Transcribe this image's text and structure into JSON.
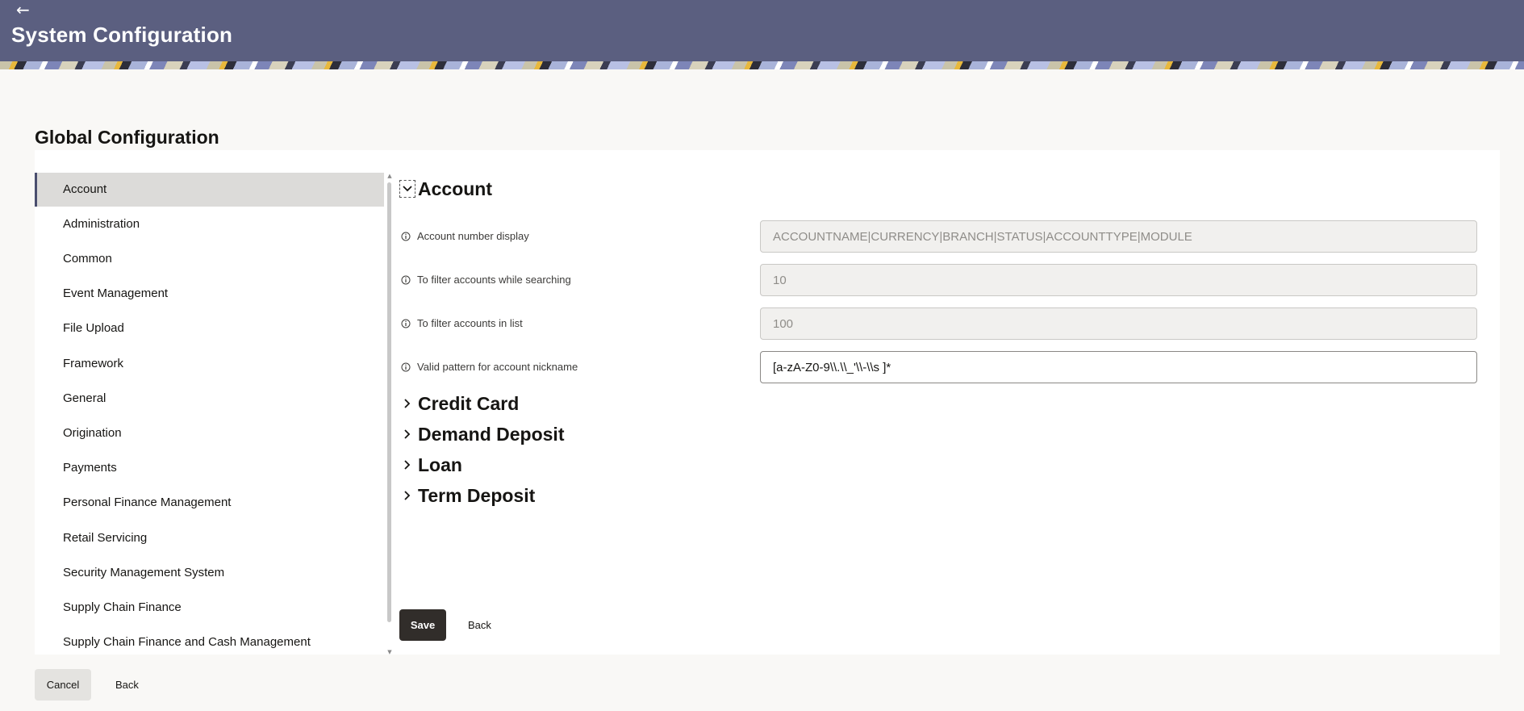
{
  "header": {
    "back_icon": "arrow-left-icon",
    "title": "System Configuration"
  },
  "section": {
    "title": "Global Configuration"
  },
  "sidebar": {
    "items": [
      {
        "label": "Account",
        "active": true
      },
      {
        "label": "Administration"
      },
      {
        "label": "Common"
      },
      {
        "label": "Event Management"
      },
      {
        "label": "File Upload"
      },
      {
        "label": "Framework"
      },
      {
        "label": "General"
      },
      {
        "label": "Origination"
      },
      {
        "label": "Payments"
      },
      {
        "label": "Personal Finance Management"
      },
      {
        "label": "Retail Servicing"
      },
      {
        "label": "Security Management System"
      },
      {
        "label": "Supply Chain Finance"
      },
      {
        "label": "Supply Chain Finance and Cash Management"
      }
    ]
  },
  "content": {
    "expanded_section": "Account",
    "fields": [
      {
        "label": "Account number display",
        "value": "ACCOUNTNAME|CURRENCY|BRANCH|STATUS|ACCOUNTTYPE|MODULE",
        "editable": false
      },
      {
        "label": "To filter accounts while searching",
        "value": "10",
        "editable": false
      },
      {
        "label": "To filter accounts in list",
        "value": "100",
        "editable": false
      },
      {
        "label": "Valid pattern for account nickname",
        "value": "[a-zA-Z0-9\\\\.\\\\_'\\\\-\\\\s ]*",
        "editable": true
      }
    ],
    "collapsed_sections": [
      "Credit Card",
      "Demand Deposit",
      "Loan",
      "Term Deposit"
    ],
    "save_label": "Save",
    "back_label": "Back"
  },
  "footer": {
    "cancel_label": "Cancel",
    "back_label": "Back"
  },
  "colors": {
    "header_bg": "#5b5f80",
    "primary_button": "#312d2a",
    "active_item_bg": "#dcdbd9"
  }
}
